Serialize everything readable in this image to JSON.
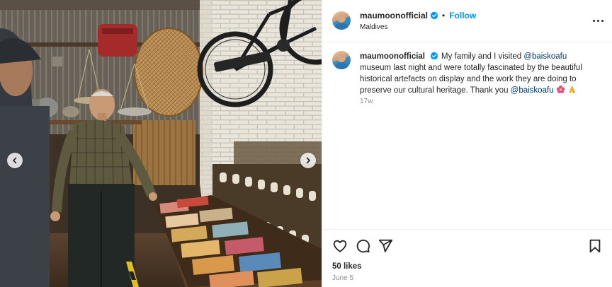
{
  "post": {
    "media": {
      "photo_description_icon": "photo-icon",
      "prev_icon": "chevron-left-icon",
      "next_icon": "chevron-right-icon"
    },
    "header": {
      "username": "maumoonofficial",
      "verified_icon": "verified-badge-icon",
      "separator": "•",
      "follow_label": "Follow",
      "location": "Maldives",
      "more_icon": "more-horizontal-icon"
    },
    "caption": {
      "username": "maumoonofficial",
      "text_1": "My family and I visited ",
      "mention_1": "@baiskoafu",
      "text_2": " museum last night and were totally fascinated by the beautiful historical artefacts on display and the work they are doing to preserve our cultural heritage. Thank you ",
      "mention_2": "@baiskoafu",
      "emoji_flower": "flower-emoji",
      "emoji_pray": "pray-emoji",
      "time_ago": "17w"
    },
    "actions": {
      "like_icon": "heart-icon",
      "comment_icon": "comment-icon",
      "share_icon": "send-icon",
      "save_icon": "bookmark-icon"
    },
    "likes": "50 likes",
    "date": "June 5"
  },
  "colors": {
    "link_blue": "#0095f6",
    "mention": "#00376b",
    "text": "#262626",
    "secondary": "#8e8e8e",
    "border": "#efefef"
  }
}
